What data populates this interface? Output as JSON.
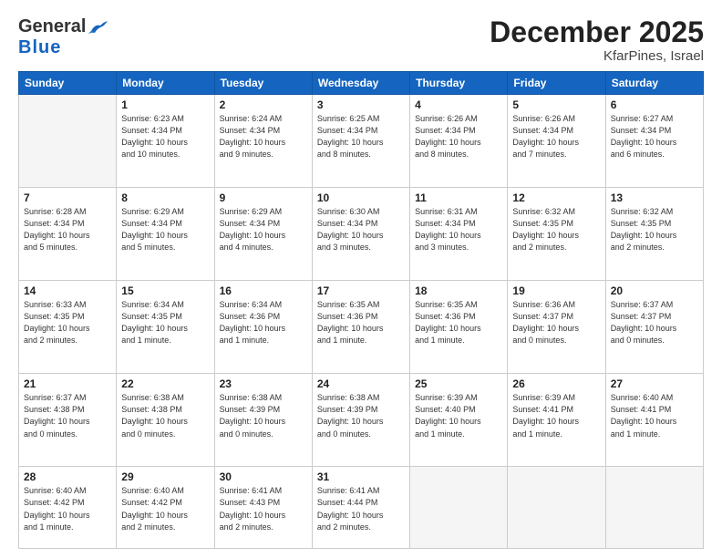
{
  "header": {
    "logo_general": "General",
    "logo_blue": "Blue",
    "title": "December 2025",
    "location": "KfarPines, Israel"
  },
  "weekdays": [
    "Sunday",
    "Monday",
    "Tuesday",
    "Wednesday",
    "Thursday",
    "Friday",
    "Saturday"
  ],
  "weeks": [
    [
      {
        "day": "",
        "info": ""
      },
      {
        "day": "1",
        "info": "Sunrise: 6:23 AM\nSunset: 4:34 PM\nDaylight: 10 hours\nand 10 minutes."
      },
      {
        "day": "2",
        "info": "Sunrise: 6:24 AM\nSunset: 4:34 PM\nDaylight: 10 hours\nand 9 minutes."
      },
      {
        "day": "3",
        "info": "Sunrise: 6:25 AM\nSunset: 4:34 PM\nDaylight: 10 hours\nand 8 minutes."
      },
      {
        "day": "4",
        "info": "Sunrise: 6:26 AM\nSunset: 4:34 PM\nDaylight: 10 hours\nand 8 minutes."
      },
      {
        "day": "5",
        "info": "Sunrise: 6:26 AM\nSunset: 4:34 PM\nDaylight: 10 hours\nand 7 minutes."
      },
      {
        "day": "6",
        "info": "Sunrise: 6:27 AM\nSunset: 4:34 PM\nDaylight: 10 hours\nand 6 minutes."
      }
    ],
    [
      {
        "day": "7",
        "info": "Sunrise: 6:28 AM\nSunset: 4:34 PM\nDaylight: 10 hours\nand 5 minutes."
      },
      {
        "day": "8",
        "info": "Sunrise: 6:29 AM\nSunset: 4:34 PM\nDaylight: 10 hours\nand 5 minutes."
      },
      {
        "day": "9",
        "info": "Sunrise: 6:29 AM\nSunset: 4:34 PM\nDaylight: 10 hours\nand 4 minutes."
      },
      {
        "day": "10",
        "info": "Sunrise: 6:30 AM\nSunset: 4:34 PM\nDaylight: 10 hours\nand 3 minutes."
      },
      {
        "day": "11",
        "info": "Sunrise: 6:31 AM\nSunset: 4:34 PM\nDaylight: 10 hours\nand 3 minutes."
      },
      {
        "day": "12",
        "info": "Sunrise: 6:32 AM\nSunset: 4:35 PM\nDaylight: 10 hours\nand 2 minutes."
      },
      {
        "day": "13",
        "info": "Sunrise: 6:32 AM\nSunset: 4:35 PM\nDaylight: 10 hours\nand 2 minutes."
      }
    ],
    [
      {
        "day": "14",
        "info": "Sunrise: 6:33 AM\nSunset: 4:35 PM\nDaylight: 10 hours\nand 2 minutes."
      },
      {
        "day": "15",
        "info": "Sunrise: 6:34 AM\nSunset: 4:35 PM\nDaylight: 10 hours\nand 1 minute."
      },
      {
        "day": "16",
        "info": "Sunrise: 6:34 AM\nSunset: 4:36 PM\nDaylight: 10 hours\nand 1 minute."
      },
      {
        "day": "17",
        "info": "Sunrise: 6:35 AM\nSunset: 4:36 PM\nDaylight: 10 hours\nand 1 minute."
      },
      {
        "day": "18",
        "info": "Sunrise: 6:35 AM\nSunset: 4:36 PM\nDaylight: 10 hours\nand 1 minute."
      },
      {
        "day": "19",
        "info": "Sunrise: 6:36 AM\nSunset: 4:37 PM\nDaylight: 10 hours\nand 0 minutes."
      },
      {
        "day": "20",
        "info": "Sunrise: 6:37 AM\nSunset: 4:37 PM\nDaylight: 10 hours\nand 0 minutes."
      }
    ],
    [
      {
        "day": "21",
        "info": "Sunrise: 6:37 AM\nSunset: 4:38 PM\nDaylight: 10 hours\nand 0 minutes."
      },
      {
        "day": "22",
        "info": "Sunrise: 6:38 AM\nSunset: 4:38 PM\nDaylight: 10 hours\nand 0 minutes."
      },
      {
        "day": "23",
        "info": "Sunrise: 6:38 AM\nSunset: 4:39 PM\nDaylight: 10 hours\nand 0 minutes."
      },
      {
        "day": "24",
        "info": "Sunrise: 6:38 AM\nSunset: 4:39 PM\nDaylight: 10 hours\nand 0 minutes."
      },
      {
        "day": "25",
        "info": "Sunrise: 6:39 AM\nSunset: 4:40 PM\nDaylight: 10 hours\nand 1 minute."
      },
      {
        "day": "26",
        "info": "Sunrise: 6:39 AM\nSunset: 4:41 PM\nDaylight: 10 hours\nand 1 minute."
      },
      {
        "day": "27",
        "info": "Sunrise: 6:40 AM\nSunset: 4:41 PM\nDaylight: 10 hours\nand 1 minute."
      }
    ],
    [
      {
        "day": "28",
        "info": "Sunrise: 6:40 AM\nSunset: 4:42 PM\nDaylight: 10 hours\nand 1 minute."
      },
      {
        "day": "29",
        "info": "Sunrise: 6:40 AM\nSunset: 4:42 PM\nDaylight: 10 hours\nand 2 minutes."
      },
      {
        "day": "30",
        "info": "Sunrise: 6:41 AM\nSunset: 4:43 PM\nDaylight: 10 hours\nand 2 minutes."
      },
      {
        "day": "31",
        "info": "Sunrise: 6:41 AM\nSunset: 4:44 PM\nDaylight: 10 hours\nand 2 minutes."
      },
      {
        "day": "",
        "info": ""
      },
      {
        "day": "",
        "info": ""
      },
      {
        "day": "",
        "info": ""
      }
    ]
  ]
}
